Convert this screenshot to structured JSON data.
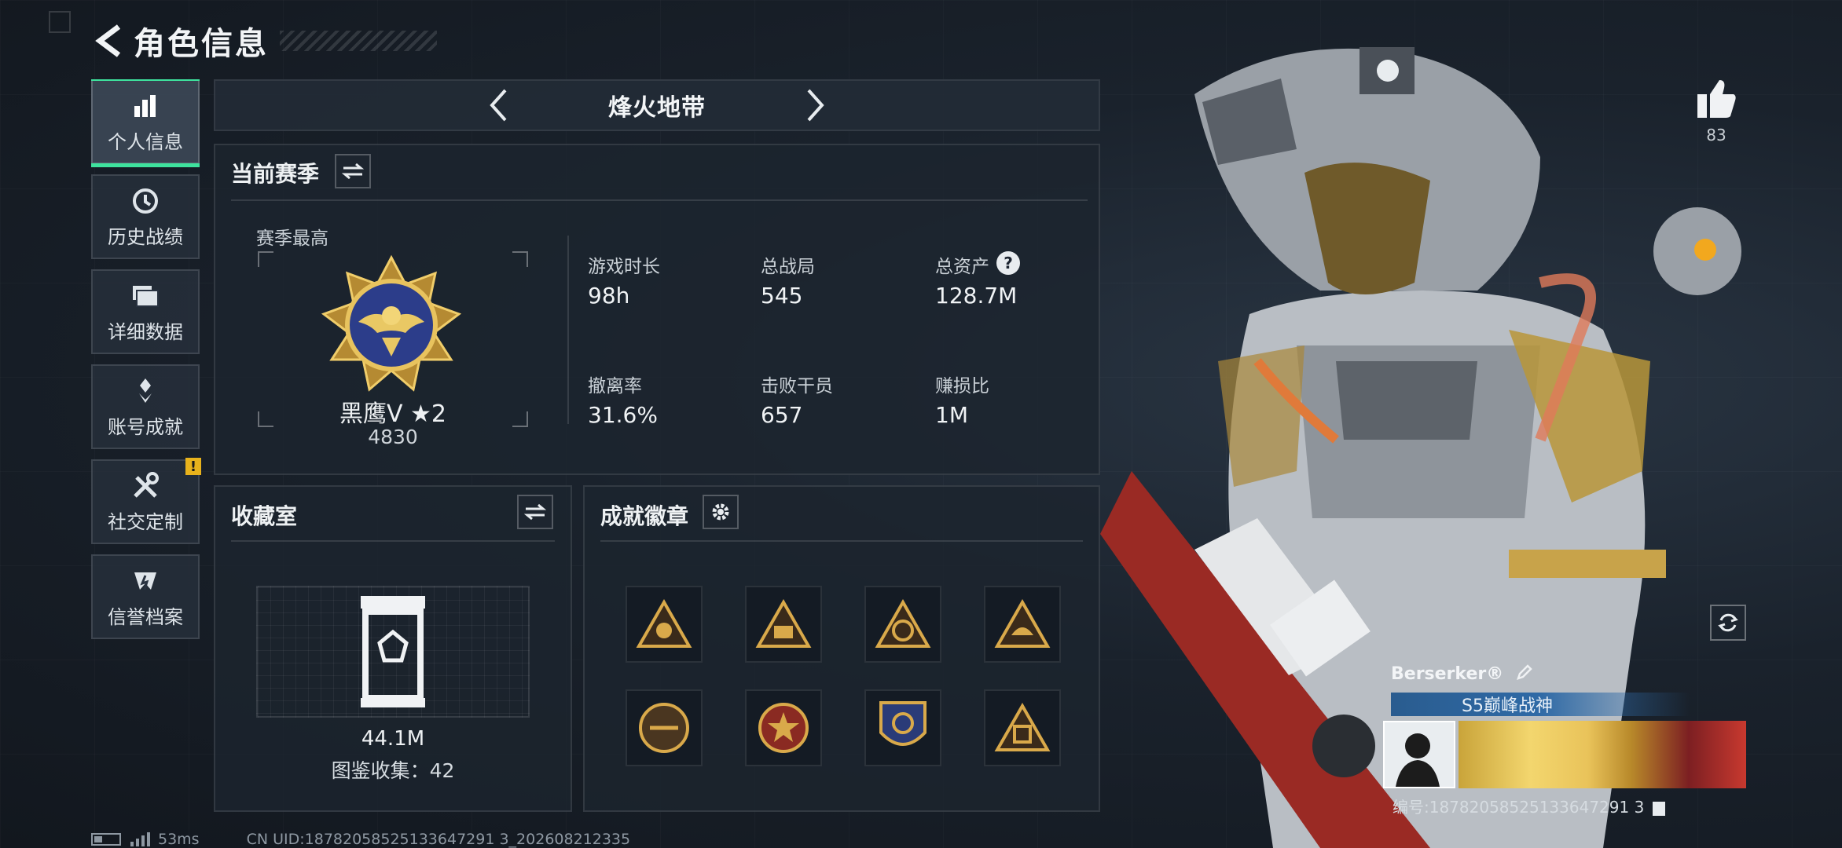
{
  "header": {
    "title": "角色信息"
  },
  "sidebar": {
    "items": [
      {
        "label": "个人信息",
        "icon": "bar-chart-icon",
        "active": true
      },
      {
        "label": "历史战绩",
        "icon": "history-clock-icon"
      },
      {
        "label": "详细数据",
        "icon": "folder-icon"
      },
      {
        "label": "账号成就",
        "icon": "achievement-icon"
      },
      {
        "label": "社交定制",
        "icon": "tools-icon",
        "alert": "!"
      },
      {
        "label": "信誉档案",
        "icon": "reputation-icon"
      }
    ]
  },
  "mode": {
    "name": "烽火地带"
  },
  "season": {
    "title": "当前赛季",
    "best_label": "赛季最高",
    "rank_name": "黑鹰V ★2",
    "rank_score": "4830",
    "stats": [
      {
        "label": "游戏时长",
        "value": "98h"
      },
      {
        "label": "总战局",
        "value": "545"
      },
      {
        "label": "总资产",
        "value": "128.7M",
        "help": "?"
      },
      {
        "label": "撤离率",
        "value": "31.6%"
      },
      {
        "label": "击败干员",
        "value": "657"
      },
      {
        "label": "赚损比",
        "value": "1M"
      }
    ]
  },
  "collection": {
    "title": "收藏室",
    "value": "44.1M",
    "count_text": "图鉴收集：42"
  },
  "achievements": {
    "title": "成就徽章",
    "badges": [
      "badge-1",
      "badge-2",
      "badge-3",
      "badge-4",
      "badge-5",
      "badge-6",
      "badge-7",
      "badge-8"
    ]
  },
  "profile": {
    "likes": "83",
    "player_name": "Berserker®",
    "title": "S5巅峰战神",
    "player_id": "编号:18782058525133647291 3"
  },
  "status": {
    "ping": "53ms",
    "uid": "CN UID:18782058525133647291 3_202608212335"
  },
  "colors": {
    "accent": "#3ee39e",
    "gold": "#c9a43a",
    "alert": "#e8b21c"
  }
}
